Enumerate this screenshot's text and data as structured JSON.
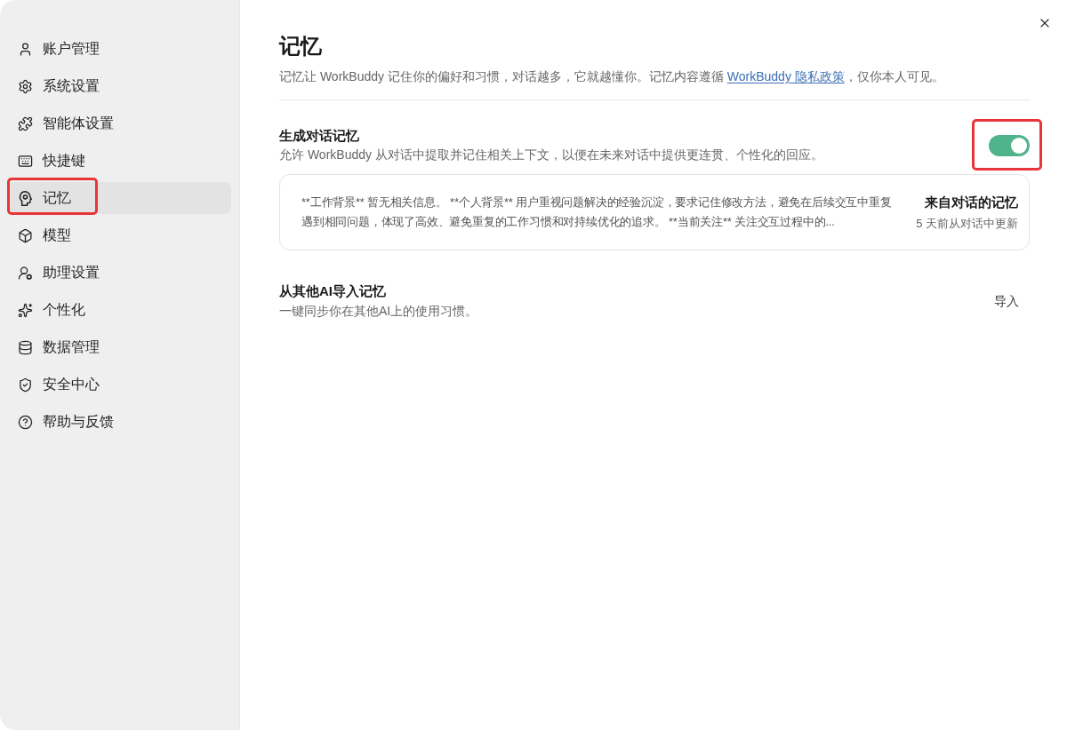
{
  "sidebar": {
    "items": [
      {
        "label": "账户管理",
        "selected": false,
        "highlighted": false
      },
      {
        "label": "系统设置",
        "selected": false,
        "highlighted": false
      },
      {
        "label": "智能体设置",
        "selected": false,
        "highlighted": false
      },
      {
        "label": "快捷键",
        "selected": false,
        "highlighted": false
      },
      {
        "label": "记忆",
        "selected": true,
        "highlighted": true
      },
      {
        "label": "模型",
        "selected": false,
        "highlighted": false
      },
      {
        "label": "助理设置",
        "selected": false,
        "highlighted": false
      },
      {
        "label": "个性化",
        "selected": false,
        "highlighted": false
      },
      {
        "label": "数据管理",
        "selected": false,
        "highlighted": false
      },
      {
        "label": "安全中心",
        "selected": false,
        "highlighted": false
      },
      {
        "label": "帮助与反馈",
        "selected": false,
        "highlighted": false
      }
    ]
  },
  "page": {
    "title": "记忆",
    "intro": {
      "text": "记忆让 WorkBuddy 记住你的偏好和习惯，对话越多，它就越懂你。记忆内容遵循",
      "link": "WorkBuddy 隐私政策",
      "suffix": "，仅你本人可见。"
    }
  },
  "memory_toggle": {
    "title": "生成对话记忆",
    "description": "允许 WorkBuddy 从对话中提取并记住相关上下文，以便在未来对话中提供更连贯、个性化的回应。",
    "on": true,
    "highlighted": true
  },
  "memory_card": {
    "summary": "**工作背景** 暂无相关信息。 **个人背景** 用户重视问题解决的经验沉淀，要求记住修改方法，避免在后续交互中重复遇到相同问题，体现了高效、避免重复的工作习惯和对持续优化的追求。 **当前关注** 关注交互过程中的...",
    "title": "来自对话的记忆",
    "updated": "5 天前从对话中更新"
  },
  "import": {
    "title": "从其他AI导入记忆",
    "description": "一键同步你在其他AI上的使用习惯。",
    "button": "导入"
  }
}
